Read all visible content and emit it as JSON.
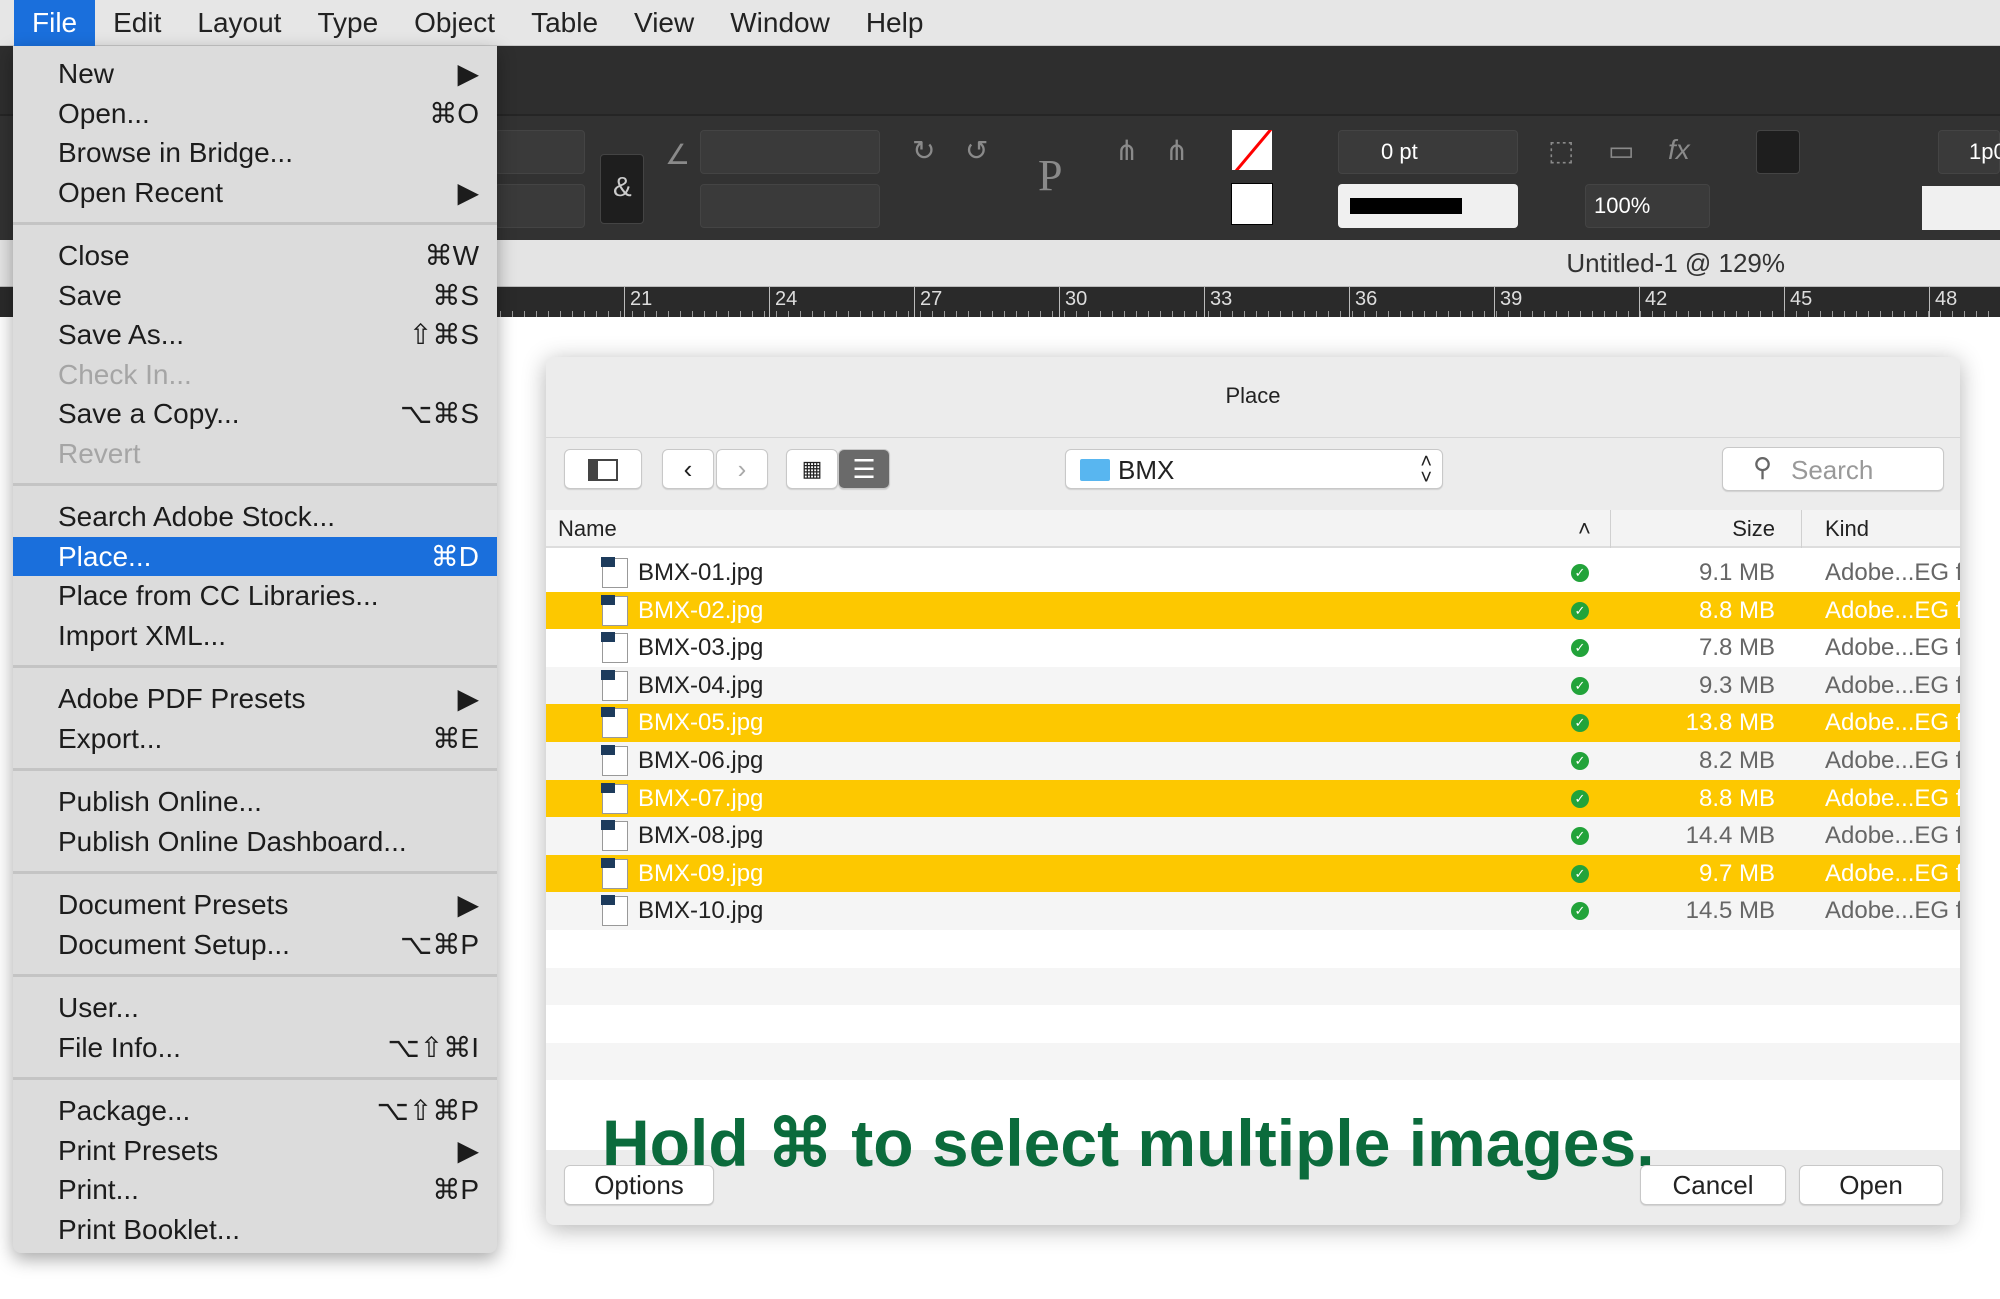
{
  "menubar": [
    "File",
    "Edit",
    "Layout",
    "Type",
    "Object",
    "Table",
    "View",
    "Window",
    "Help"
  ],
  "toolbar": {
    "stroke_weight": "0 pt",
    "opacity": "100%",
    "ref": "1p0"
  },
  "document": {
    "title": "Untitled-1 @ 129%"
  },
  "ruler": [
    "21",
    "24",
    "27",
    "30",
    "33",
    "36",
    "39",
    "42",
    "45",
    "48"
  ],
  "file_menu": [
    [
      {
        "label": "New",
        "sc": "▶"
      },
      {
        "label": "Open...",
        "sc": "⌘O"
      },
      {
        "label": "Browse in Bridge...",
        "sc": ""
      },
      {
        "label": "Open Recent",
        "sc": "▶"
      }
    ],
    [
      {
        "label": "Close",
        "sc": "⌘W"
      },
      {
        "label": "Save",
        "sc": "⌘S"
      },
      {
        "label": "Save As...",
        "sc": "⇧⌘S"
      },
      {
        "label": "Check In...",
        "sc": "",
        "disabled": true
      },
      {
        "label": "Save a Copy...",
        "sc": "⌥⌘S"
      },
      {
        "label": "Revert",
        "sc": "",
        "disabled": true
      }
    ],
    [
      {
        "label": "Search Adobe Stock...",
        "sc": ""
      },
      {
        "label": "Place...",
        "sc": "⌘D",
        "highlighted": true
      },
      {
        "label": "Place from CC Libraries...",
        "sc": ""
      },
      {
        "label": "Import XML...",
        "sc": ""
      }
    ],
    [
      {
        "label": "Adobe PDF Presets",
        "sc": "▶"
      },
      {
        "label": "Export...",
        "sc": "⌘E"
      }
    ],
    [
      {
        "label": "Publish Online...",
        "sc": ""
      },
      {
        "label": "Publish Online Dashboard...",
        "sc": ""
      }
    ],
    [
      {
        "label": "Document Presets",
        "sc": "▶"
      },
      {
        "label": "Document Setup...",
        "sc": "⌥⌘P"
      }
    ],
    [
      {
        "label": "User...",
        "sc": ""
      },
      {
        "label": "File Info...",
        "sc": "⌥⇧⌘I"
      }
    ],
    [
      {
        "label": "Package...",
        "sc": "⌥⇧⌘P"
      },
      {
        "label": "Print Presets",
        "sc": "▶"
      },
      {
        "label": "Print...",
        "sc": "⌘P"
      },
      {
        "label": "Print Booklet...",
        "sc": ""
      }
    ]
  ],
  "dialog": {
    "title": "Place",
    "folder": "BMX",
    "search_placeholder": "Search",
    "columns": {
      "name": "Name",
      "size": "Size",
      "kind": "Kind"
    },
    "files": [
      {
        "name": "BMX-01.jpg",
        "size": "9.1 MB",
        "kind": "Adobe...EG file",
        "selected": false
      },
      {
        "name": "BMX-02.jpg",
        "size": "8.8 MB",
        "kind": "Adobe...EG file",
        "selected": true
      },
      {
        "name": "BMX-03.jpg",
        "size": "7.8 MB",
        "kind": "Adobe...EG file",
        "selected": false
      },
      {
        "name": "BMX-04.jpg",
        "size": "9.3 MB",
        "kind": "Adobe...EG file",
        "selected": false
      },
      {
        "name": "BMX-05.jpg",
        "size": "13.8 MB",
        "kind": "Adobe...EG file",
        "selected": true
      },
      {
        "name": "BMX-06.jpg",
        "size": "8.2 MB",
        "kind": "Adobe...EG file",
        "selected": false
      },
      {
        "name": "BMX-07.jpg",
        "size": "8.8 MB",
        "kind": "Adobe...EG file",
        "selected": true
      },
      {
        "name": "BMX-08.jpg",
        "size": "14.4 MB",
        "kind": "Adobe...EG file",
        "selected": false
      },
      {
        "name": "BMX-09.jpg",
        "size": "9.7 MB",
        "kind": "Adobe...EG file",
        "selected": true
      },
      {
        "name": "BMX-10.jpg",
        "size": "14.5 MB",
        "kind": "Adobe...EG file",
        "selected": false
      }
    ],
    "hint": "Hold ⌘ to select multiple images.",
    "options": "Options",
    "cancel": "Cancel",
    "open": "Open"
  },
  "colors": {
    "selection": "#fdc800",
    "menu_highlight": "#1a6fdc",
    "hint": "#0b6b3c"
  }
}
